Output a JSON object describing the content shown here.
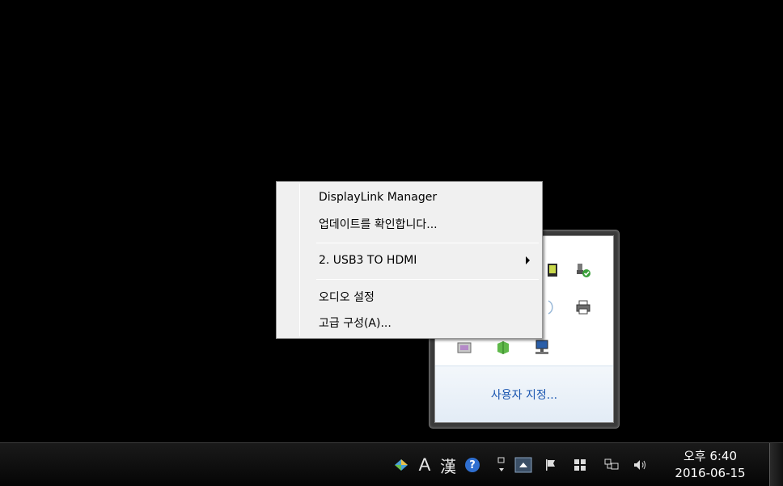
{
  "context_menu": {
    "items": [
      {
        "label": "DisplayLink Manager"
      },
      {
        "label": "업데이트를 확인합니다..."
      },
      {
        "label": "2. USB3 TO HDMI",
        "submenu": true
      },
      {
        "label": "오디오 설정"
      },
      {
        "label": "고급 구성(A)..."
      }
    ]
  },
  "tray_flyout": {
    "customize_link": "사용자 지정..."
  },
  "taskbar": {
    "ime_mode": "A",
    "ime_hanja": "漢",
    "help_glyph": "?",
    "clock_time": "오후 6:40",
    "clock_date": "2016-06-15"
  },
  "colors": {
    "menu_bg": "#f0f0f0",
    "link": "#1a56b0",
    "taskbar": "#0a0a0a"
  }
}
